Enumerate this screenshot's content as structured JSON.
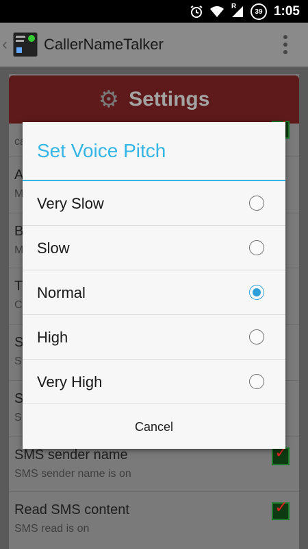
{
  "status_bar": {
    "time": "1:05",
    "battery_level": "39",
    "signal_tag": "R",
    "icons": [
      "alarm-icon",
      "wifi-icon",
      "signal-icon",
      "battery-icon"
    ]
  },
  "action_bar": {
    "app_title": "CallerNameTalker"
  },
  "settings": {
    "header_title": "Settings",
    "background_rows": [
      {
        "title": "",
        "subtitle": "ca"
      },
      {
        "title": "A",
        "subtitle": "M"
      },
      {
        "title": "B",
        "subtitle": "M"
      },
      {
        "title": "T",
        "subtitle": "C"
      },
      {
        "title": "S",
        "subtitle": "S"
      },
      {
        "title": "S",
        "subtitle": "S"
      },
      {
        "title": "SMS sender name",
        "subtitle": "SMS sender name is on"
      },
      {
        "title": "Read SMS content",
        "subtitle": "SMS read is on"
      }
    ]
  },
  "dialog": {
    "title": "Set Voice Pitch",
    "options": [
      {
        "label": "Very Slow",
        "selected": false
      },
      {
        "label": "Slow",
        "selected": false
      },
      {
        "label": "Normal",
        "selected": true
      },
      {
        "label": "High",
        "selected": false
      },
      {
        "label": "Very High",
        "selected": false
      }
    ],
    "cancel_label": "Cancel"
  },
  "colors": {
    "accent": "#33b5e5",
    "header_red": "#5e1a1a",
    "checkbox_tick": "#dd2222"
  }
}
